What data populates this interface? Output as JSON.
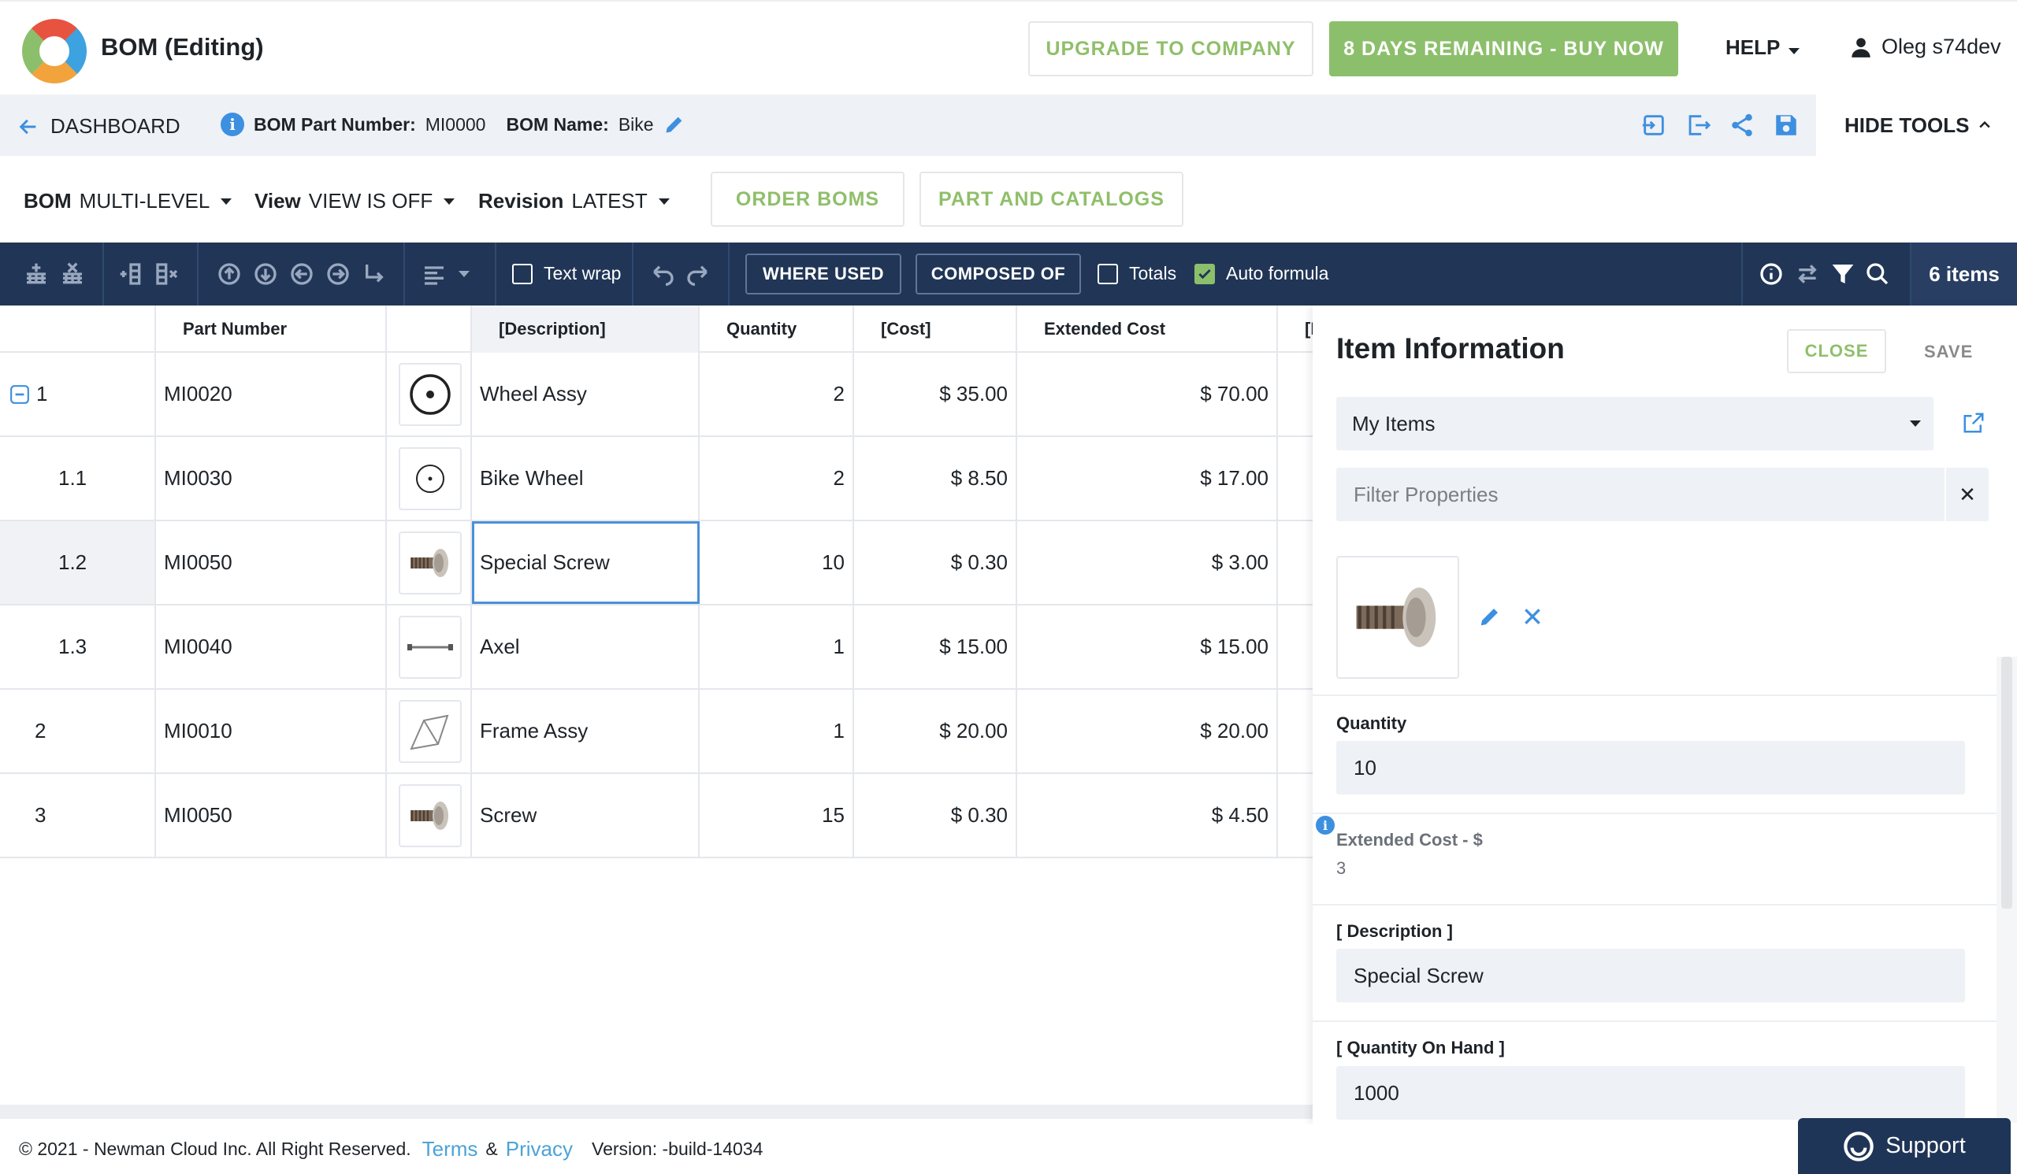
{
  "header": {
    "app_title": "BOM (Editing)",
    "upgrade_label": "UPGRADE TO COMPANY",
    "buy_label": "8 DAYS REMAINING - BUY NOW",
    "help_label": "HELP",
    "user_name": "Oleg s74dev"
  },
  "subheader": {
    "dashboard_label": "DASHBOARD",
    "part_number_label": "BOM Part Number:",
    "part_number_value": "MI0000",
    "bom_name_label": "BOM Name:",
    "bom_name_value": "Bike",
    "hide_tools_label": "HIDE TOOLS"
  },
  "controls": {
    "bom_label": "BOM",
    "bom_value": "MULTI-LEVEL",
    "view_label": "View",
    "view_value": "VIEW IS OFF",
    "revision_label": "Revision",
    "revision_value": "LATEST",
    "order_boms_label": "ORDER BOMS",
    "part_catalogs_label": "PART AND CATALOGS"
  },
  "toolbar": {
    "text_wrap_label": "Text wrap",
    "where_used_label": "WHERE USED",
    "composed_of_label": "COMPOSED OF",
    "totals_label": "Totals",
    "auto_formula_label": "Auto formula",
    "items_count": "6 items"
  },
  "grid": {
    "columns": [
      "",
      "Part Number",
      "",
      "[Description]",
      "Quantity",
      "[Cost]",
      "Extended Cost",
      "[I"
    ],
    "rows": [
      {
        "level": "1",
        "part": "MI0020",
        "image": "wheel-assy",
        "desc": "Wheel Assy",
        "qty": "2",
        "cost": "$ 35.00",
        "ext": "$ 70.00"
      },
      {
        "level": "1.1",
        "part": "MI0030",
        "image": "bike-wheel",
        "desc": "Bike Wheel",
        "qty": "2",
        "cost": "$ 8.50",
        "ext": "$ 17.00"
      },
      {
        "level": "1.2",
        "part": "MI0050",
        "image": "screw",
        "desc": "Special Screw",
        "qty": "10",
        "cost": "$ 0.30",
        "ext": "$ 3.00"
      },
      {
        "level": "1.3",
        "part": "MI0040",
        "image": "axel",
        "desc": "Axel",
        "qty": "1",
        "cost": "$ 15.00",
        "ext": "$ 15.00"
      },
      {
        "level": "2",
        "part": "MI0010",
        "image": "frame",
        "desc": "Frame Assy",
        "qty": "1",
        "cost": "$ 20.00",
        "ext": "$ 20.00"
      },
      {
        "level": "3",
        "part": "MI0050",
        "image": "screw",
        "desc": "Screw",
        "qty": "15",
        "cost": "$ 0.30",
        "ext": "$ 4.50"
      }
    ]
  },
  "panel": {
    "title": "Item Information",
    "close_label": "CLOSE",
    "save_label": "SAVE",
    "source_value": "My Items",
    "filter_placeholder": "Filter Properties",
    "quantity_label": "Quantity",
    "quantity_value": "10",
    "ext_cost_label": "Extended Cost - $",
    "ext_cost_value": "3",
    "description_label": "[ Description ]",
    "description_value": "Special Screw",
    "qoh_label": "[ Quantity On Hand ]",
    "qoh_value": "1000"
  },
  "footer": {
    "copyright": "© 2021 - Newman Cloud Inc. All Right Reserved.",
    "terms": "Terms",
    "amp": "&",
    "privacy": "Privacy",
    "version": "Version: -build-14034",
    "support_label": "Support"
  },
  "colors": {
    "accent_green": "#8cbf6b",
    "navy": "#213656",
    "link_blue": "#4aa3d8",
    "selection_blue": "#4a90d9"
  }
}
